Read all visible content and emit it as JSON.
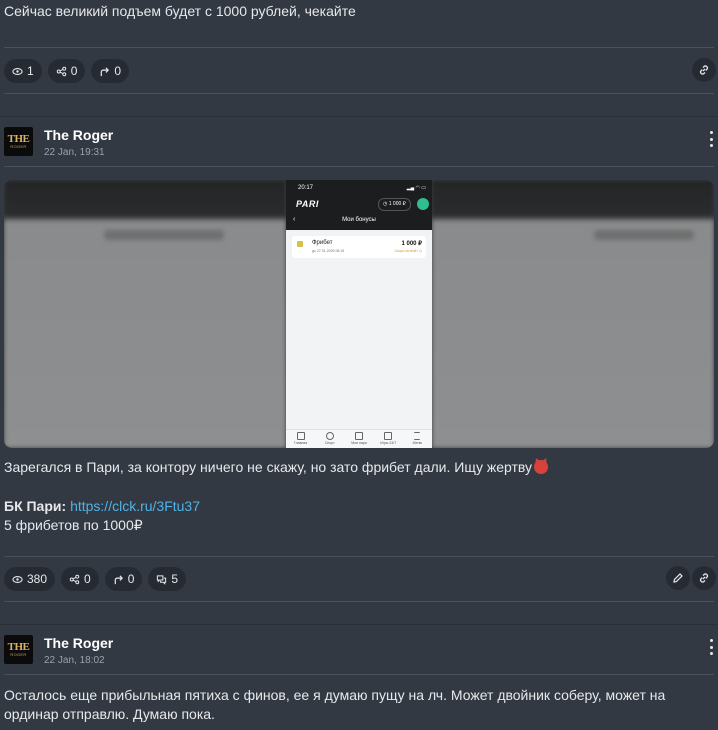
{
  "post1": {
    "text": "Сейчас великий подъем будет с 1000 рублей, чекайте",
    "views": "1",
    "shares": "0",
    "forwards": "0"
  },
  "post2": {
    "author": "The Roger",
    "date": "22 Jan, 19:31",
    "avatar_line1": "THE",
    "avatar_line2": "ROGER",
    "phone": {
      "time": "20:17",
      "status": "▂▄ ◠ ▭",
      "logo": "PARI",
      "balance": "◷ 1 000 ₽",
      "back": "‹",
      "title": "Мои бонусы",
      "card_title": "Фрибет",
      "card_date": "до 27.01.2025 08:15",
      "card_amount": "1 000 ₽",
      "card_status": "Скоро истечёт ◷",
      "nav": [
        "Главная",
        "Спорт",
        "Мои пари",
        "Игры 24/7",
        "Меню"
      ]
    },
    "line1": "Зарегался в Пари, за контору ничего не скажу, но зато фрибет дали. Ищу жертву",
    "bk_label": "БК Пари:",
    "bk_link": "https://clck.ru/3Ftu37",
    "line3": "5 фрибетов по 1000₽",
    "views": "380",
    "shares": "0",
    "forwards": "0",
    "comments": "5"
  },
  "post3": {
    "author": "The Roger",
    "date": "22 Jan, 18:02",
    "avatar_line1": "THE",
    "avatar_line2": "ROGER",
    "text": "Осталось еще прибыльная пятиха с финов, ее я думаю пущу на лч. Может двойник соберу, может на ординар отправлю. Думаю пока."
  },
  "colors": {
    "background": "#333943",
    "pill": "#262b33",
    "link": "#4fb3e8"
  }
}
